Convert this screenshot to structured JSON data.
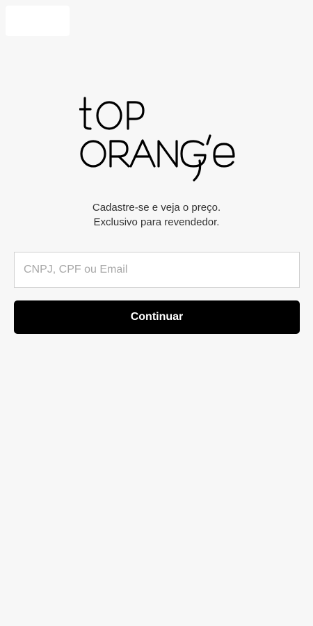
{
  "logo": {
    "line1": "tOP",
    "line2": "ORANG'E",
    "color": "#000000"
  },
  "tagline": {
    "line1": "Cadastre-se e veja o preço.",
    "line2": "Exclusivo para revendedor."
  },
  "form": {
    "identifier_placeholder": "CNPJ, CPF ou Email",
    "identifier_value": "",
    "continue_label": "Continuar"
  },
  "colors": {
    "background": "#f7f7f7",
    "button": "#000000",
    "button_text": "#ffffff"
  }
}
